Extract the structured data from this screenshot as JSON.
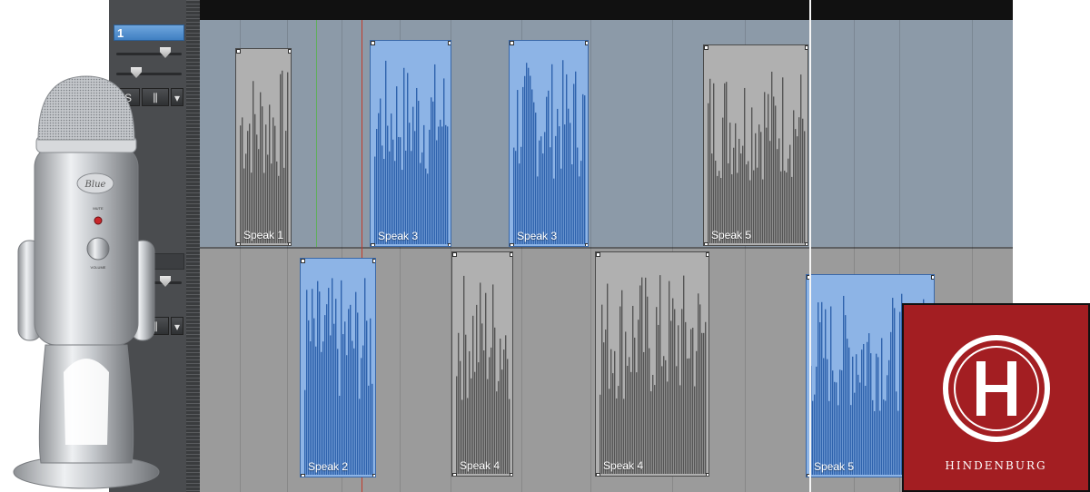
{
  "tracks": [
    {
      "name": "1"
    },
    {
      "name": ""
    }
  ],
  "buttons": {
    "solo_label": "S",
    "mixer_icon": "mixer-icon",
    "menu_icon": "chevron-down-icon"
  },
  "clips": [
    {
      "label": "Speak 1",
      "color": "gray",
      "lane": 1
    },
    {
      "label": "Speak 3",
      "color": "blue",
      "lane": 1
    },
    {
      "label": "Speak 3",
      "color": "blue",
      "lane": 1
    },
    {
      "label": "Speak 5",
      "color": "gray",
      "lane": 1
    },
    {
      "label": "Speak 2",
      "color": "blue",
      "lane": 2
    },
    {
      "label": "Speak 4",
      "color": "gray",
      "lane": 2
    },
    {
      "label": "Speak 4",
      "color": "gray",
      "lane": 2
    },
    {
      "label": "Speak 5",
      "color": "blue",
      "lane": 2
    }
  ],
  "logo": {
    "text": "HINDENBURG",
    "brand_color": "#a31e22"
  },
  "mic": {
    "brand": "Blue",
    "mute_label": "MUTE",
    "volume_label": "VOLUME"
  },
  "colors": {
    "waveform_gray": "#555555",
    "waveform_blue": "#2f63ad",
    "lane1_bg": "#8c9aa8",
    "lane2_bg": "#9b9b9b"
  }
}
